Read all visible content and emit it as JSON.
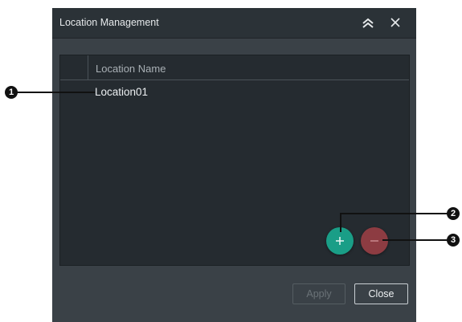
{
  "dialog": {
    "title": "Location Management",
    "collapse_icon": "double-chevron-up-icon",
    "close_icon": "close-icon"
  },
  "table": {
    "column_header": "Location Name",
    "rows": [
      {
        "name": "Location01"
      }
    ]
  },
  "actions": {
    "add_label": "+",
    "remove_label": "−",
    "apply_label": "Apply",
    "close_label": "Close"
  },
  "callouts": [
    "1",
    "2",
    "3"
  ],
  "colors": {
    "add_button": "#1a9e87",
    "remove_button": "#8d3c42",
    "background": "#3a4147",
    "titlebar": "#2b3237"
  }
}
